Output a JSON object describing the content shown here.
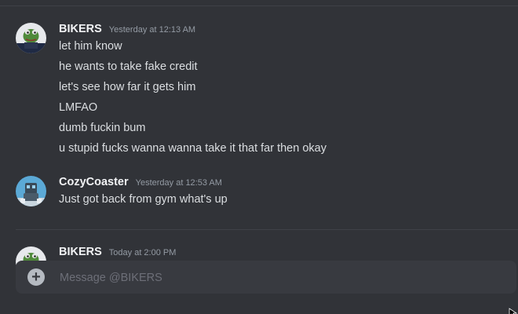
{
  "messages": [
    {
      "username": "BIKERS",
      "timestamp": "Yesterday at 12:13 AM",
      "lines": [
        "let him know",
        "he wants to take fake credit",
        "let's see how far it gets him",
        "LMFAO",
        "dumb fuckin bum",
        "u stupid fucks wanna wanna take it that far then okay"
      ],
      "avatar": "frog-avatar"
    },
    {
      "username": "CozyCoaster",
      "timestamp": "Yesterday at 12:53 AM",
      "lines": [
        "Just got back from gym what's up"
      ],
      "avatar": "robot-avatar"
    },
    {
      "username": "BIKERS",
      "timestamp": "Today at 2:00 PM",
      "lines": [],
      "avatar": "frog-avatar"
    }
  ],
  "composer": {
    "placeholder": "Message @BIKERS",
    "attach_icon": "plus-icon"
  },
  "colors": {
    "background": "#313338",
    "composer_bg": "#383a40",
    "username": "#f2f3f5",
    "timestamp": "#949ba4",
    "text": "#dbdee1"
  }
}
